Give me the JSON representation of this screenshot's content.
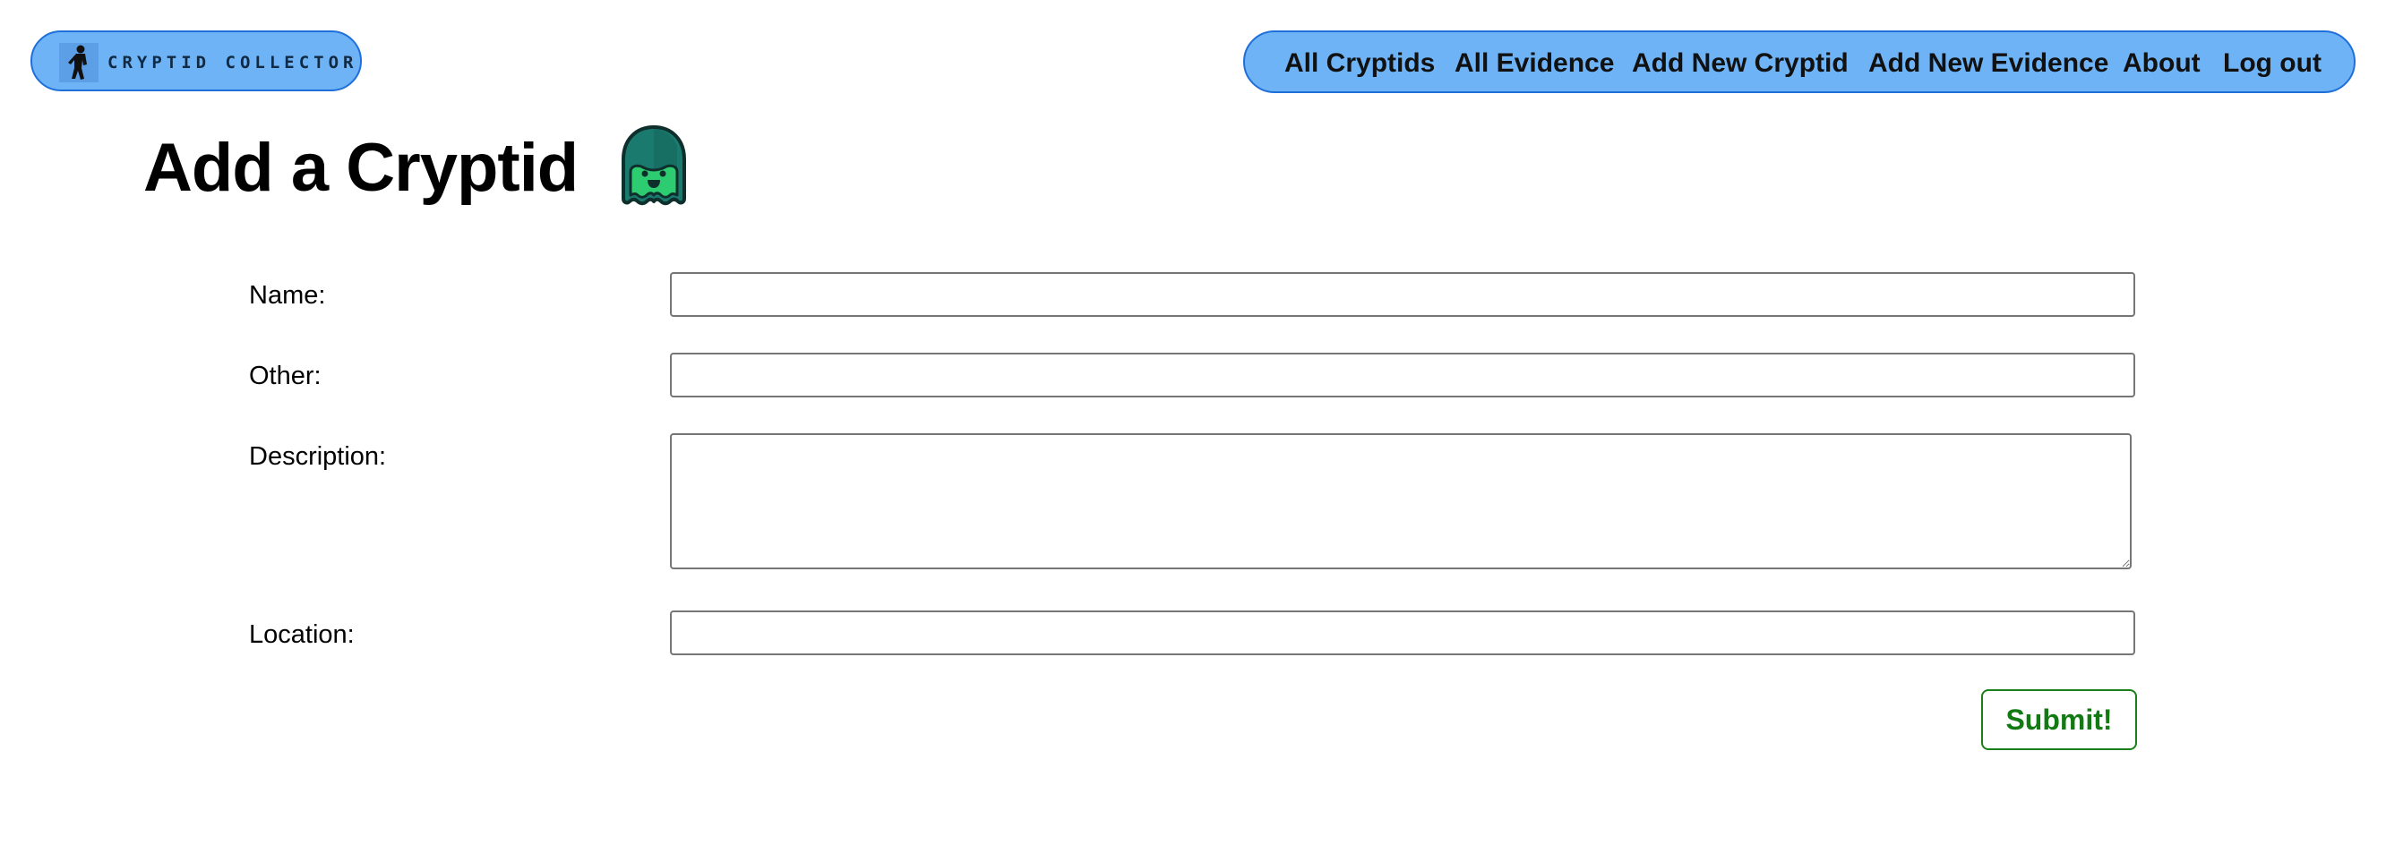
{
  "brand": {
    "logo_text": "CRYPTID COLLECTOR",
    "logo_icon": "bigfoot-icon"
  },
  "nav": {
    "items": [
      {
        "label": "All Cryptids"
      },
      {
        "label": "All Evidence"
      },
      {
        "label": "Add New Cryptid"
      },
      {
        "label": "Add New Evidence"
      },
      {
        "label": "About"
      },
      {
        "label": "Log out"
      }
    ]
  },
  "main": {
    "title": "Add a Cryptid",
    "title_icon": "ghost-icon"
  },
  "form": {
    "name": {
      "label": "Name:",
      "value": ""
    },
    "other": {
      "label": "Other:",
      "value": ""
    },
    "description": {
      "label": "Description:",
      "value": ""
    },
    "location": {
      "label": "Location:",
      "value": ""
    },
    "submit_label": "Submit!"
  },
  "colors": {
    "nav_background": "#6fb3f7",
    "nav_border": "#1f6fd9",
    "submit_accent": "#137a13",
    "ghost_body": "#1a7a6e",
    "ghost_outline": "#0f2f2c",
    "ghost_face": "#2ecc71"
  }
}
